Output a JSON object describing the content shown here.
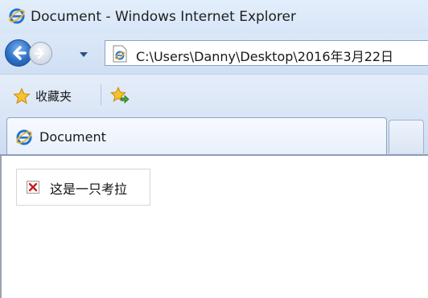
{
  "window": {
    "title": "Document - Windows Internet Explorer"
  },
  "navigation": {
    "address": "C:\\Users\\Danny\\Desktop\\2016年3月22日"
  },
  "favorites_bar": {
    "favorites_label": "收藏夹"
  },
  "tabs": [
    {
      "title": "Document",
      "active": true
    }
  ],
  "page": {
    "image_alt": "这是一只考拉"
  },
  "icons": {
    "browser": "ie-icon",
    "back": "back-arrow-icon",
    "forward": "forward-arrow-icon",
    "dropdown": "chevron-down-icon",
    "page": "ie-page-icon",
    "favorites": "star-icon",
    "add_favorite": "add-to-favorites-icon",
    "broken_image": "broken-image-icon"
  },
  "colors": {
    "chrome": "#d7e6f8",
    "back_button": "#2d6fc6",
    "broken_image_x": "#d11a1a"
  }
}
